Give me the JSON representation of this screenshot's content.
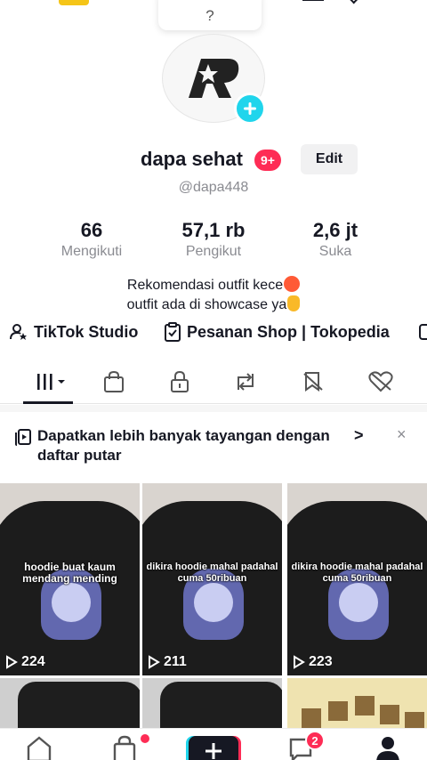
{
  "top": {
    "bubble_mark": "?"
  },
  "profile": {
    "username": "dapa sehat",
    "notif_badge": "9+",
    "edit_label": "Edit",
    "handle": "@dapa448"
  },
  "stats": [
    {
      "value": "66",
      "label": "Mengikuti"
    },
    {
      "value": "57,1 rb",
      "label": "Pengikut"
    },
    {
      "value": "2,6 jt",
      "label": "Suka"
    }
  ],
  "bio": {
    "line1": "Rekomendasi outfit kece",
    "line2": "outfit ada di showcase ya"
  },
  "links": {
    "studio": "TikTok Studio",
    "shop": "Pesanan Shop | Tokopedia"
  },
  "tabs": [
    {
      "icon": "grid-icon",
      "active": true
    },
    {
      "icon": "shopping-bag-icon"
    },
    {
      "icon": "lock-icon"
    },
    {
      "icon": "repost-icon"
    },
    {
      "icon": "bookmark-eye-icon"
    },
    {
      "icon": "heart-eye-icon"
    }
  ],
  "banner": {
    "text": "Dapatkan lebih banyak tayangan dengan daftar putar",
    "chevron": ">",
    "close": "×"
  },
  "videos": [
    {
      "caption": "hoodie buat kaum mendang mending",
      "views": "224"
    },
    {
      "caption": "dikira hoodie mahal padahal cuma 50ribuan",
      "views": "211"
    },
    {
      "caption": "dikira hoodie mahal padahal cuma 50ribuan",
      "views": "223"
    }
  ],
  "nav": {
    "inbox_badge": "2"
  },
  "colors": {
    "accent_red": "#fe2c55",
    "accent_cyan": "#20d5ec",
    "text": "#161823",
    "muted": "#8a8b91"
  }
}
